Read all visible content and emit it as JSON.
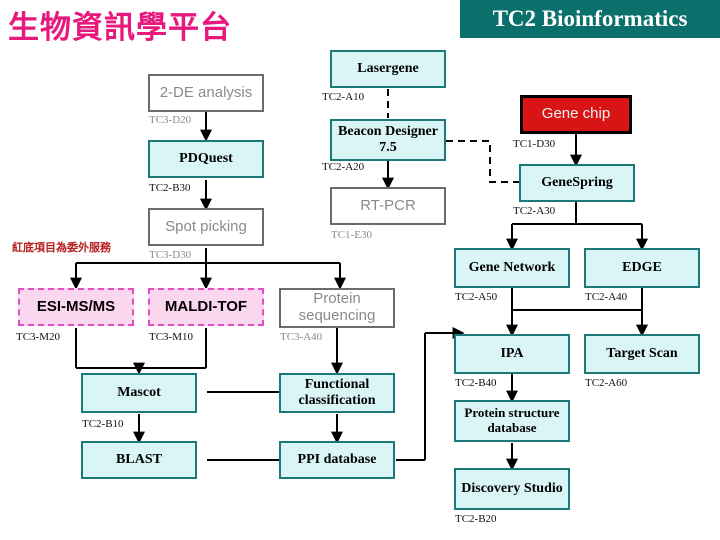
{
  "header": {
    "title_cn": "生物資訊學平台",
    "title_en": "TC2 Bioinformatics",
    "bar_color": "#0b706b",
    "title_cn_color": "#e8197d"
  },
  "note": {
    "text": "紅底項目為委外服務",
    "color": "#b52020"
  },
  "legend_colors": {
    "teal_fill": "#d9f5f5",
    "teal_border": "#1b7a77",
    "gray_border": "#6b6b6b",
    "pink_fill": "#fbd6ef",
    "pink_border": "#e24fc0",
    "red_fill": "#d81414"
  },
  "nodes": [
    {
      "id": "two_de",
      "label": "2-DE analysis",
      "style": "gray",
      "code": "TC3-D20"
    },
    {
      "id": "pdquest",
      "label": "PDQuest",
      "style": "teal",
      "code": "TC2-B30"
    },
    {
      "id": "spot_picking",
      "label": "Spot picking",
      "style": "gray",
      "code": "TC3-D30"
    },
    {
      "id": "esi_msms",
      "label": "ESI-MS/MS",
      "style": "pink",
      "code": "TC3-M20"
    },
    {
      "id": "maldi_tof",
      "label": "MALDI-TOF",
      "style": "pink",
      "code": "TC3-M10"
    },
    {
      "id": "protein_seq",
      "label": "Protein sequencing",
      "style": "gray",
      "code": "TC3-A40"
    },
    {
      "id": "mascot",
      "label": "Mascot",
      "style": "teal",
      "code": "TC2-B10"
    },
    {
      "id": "blast",
      "label": "BLAST",
      "style": "teal",
      "code": ""
    },
    {
      "id": "func_class",
      "label": "Functional classification",
      "style": "teal",
      "code": ""
    },
    {
      "id": "ppi_db",
      "label": "PPI database",
      "style": "teal",
      "code": ""
    },
    {
      "id": "lasergene",
      "label": "Lasergene",
      "style": "teal",
      "code": "TC2-A10"
    },
    {
      "id": "beacon",
      "label": "Beacon Designer 7.5",
      "style": "teal",
      "code": "TC2-A20"
    },
    {
      "id": "rt_pcr",
      "label": "RT-PCR",
      "style": "gray",
      "code": "TC1-E30"
    },
    {
      "id": "gene_chip",
      "label": "Gene chip",
      "style": "red",
      "code": "TC1-D30"
    },
    {
      "id": "genespring",
      "label": "GeneSpring",
      "style": "teal",
      "code": "TC2-A30"
    },
    {
      "id": "gene_network",
      "label": "Gene Network",
      "style": "teal",
      "code": "TC2-A50"
    },
    {
      "id": "edge",
      "label": "EDGE",
      "style": "teal",
      "code": "TC2-A40"
    },
    {
      "id": "ipa",
      "label": "IPA",
      "style": "teal",
      "code": "TC2-B40"
    },
    {
      "id": "target_scan",
      "label": "Target Scan",
      "style": "teal",
      "code": "TC2-A60"
    },
    {
      "id": "protein_struct",
      "label": "Protein structure database",
      "style": "teal",
      "code": ""
    },
    {
      "id": "discovery",
      "label": "Discovery Studio",
      "style": "teal",
      "code": "TC2-B20"
    }
  ]
}
